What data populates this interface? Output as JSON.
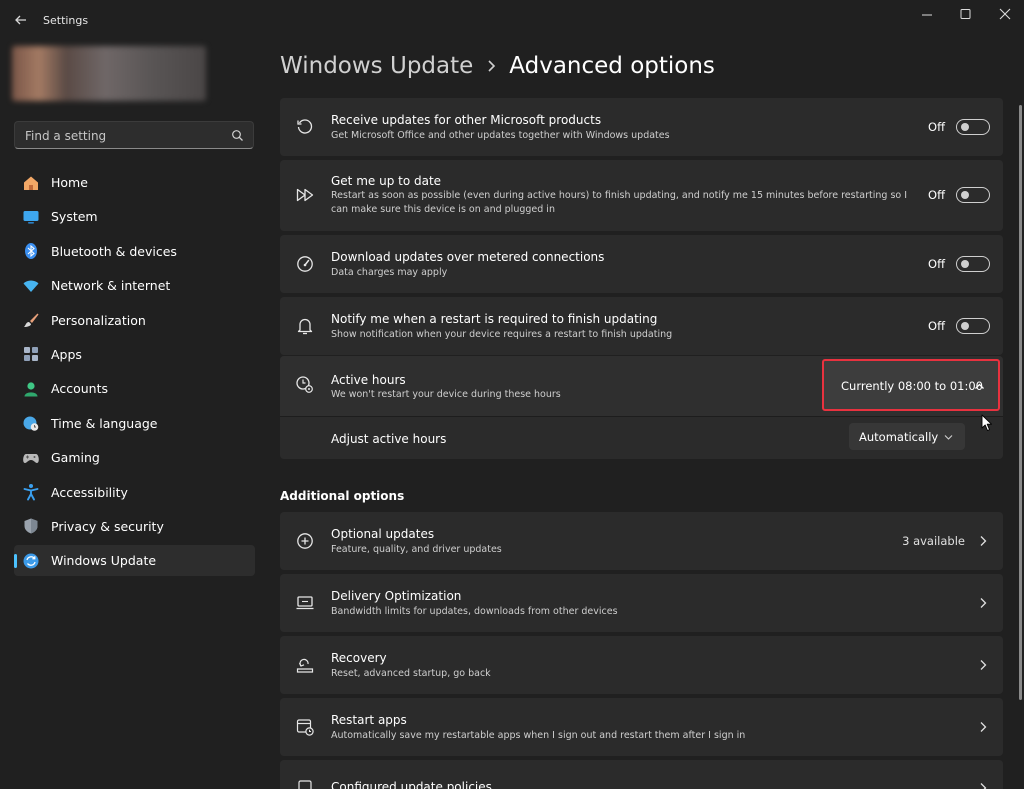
{
  "window": {
    "title": "Settings"
  },
  "search": {
    "placeholder": "Find a setting"
  },
  "sidebar": {
    "items": [
      {
        "label": "Home",
        "icon": "home-icon",
        "color": "#f2a766"
      },
      {
        "label": "System",
        "icon": "system-icon",
        "color": "#3ea7ef"
      },
      {
        "label": "Bluetooth & devices",
        "icon": "bluetooth-icon",
        "color": "#3b8ff0"
      },
      {
        "label": "Network & internet",
        "icon": "network-icon",
        "color": "#47b4f0"
      },
      {
        "label": "Personalization",
        "icon": "brush-icon",
        "color": "#e8a07a"
      },
      {
        "label": "Apps",
        "icon": "apps-icon",
        "color": "#a9b6c9"
      },
      {
        "label": "Accounts",
        "icon": "accounts-icon",
        "color": "#3fc785"
      },
      {
        "label": "Time & language",
        "icon": "globe-clock-icon",
        "color": "#4aa8e8"
      },
      {
        "label": "Gaming",
        "icon": "gamepad-icon",
        "color": "#b9b9b9"
      },
      {
        "label": "Accessibility",
        "icon": "accessibility-icon",
        "color": "#3aa0f0"
      },
      {
        "label": "Privacy & security",
        "icon": "shield-icon",
        "color": "#9aa3ad"
      },
      {
        "label": "Windows Update",
        "icon": "update-icon",
        "color": "#3b9ae8",
        "selected": true
      }
    ]
  },
  "header": {
    "parent": "Windows Update",
    "current": "Advanced options"
  },
  "settings": [
    {
      "title": "Receive updates for other Microsoft products",
      "desc": "Get Microsoft Office and other updates together with Windows updates",
      "state": "Off"
    },
    {
      "title": "Get me up to date",
      "desc": "Restart as soon as possible (even during active hours) to finish updating, and notify me 15 minutes before restarting so I can make sure this device is on and plugged in",
      "state": "Off"
    },
    {
      "title": "Download updates over metered connections",
      "desc": "Data charges may apply",
      "state": "Off"
    },
    {
      "title": "Notify me when a restart is required to finish updating",
      "desc": "Show notification when your device requires a restart to finish updating",
      "state": "Off"
    }
  ],
  "active_hours": {
    "title": "Active hours",
    "desc": "We won't restart your device during these hours",
    "current": "Currently 08:00 to 01:00",
    "adjust_label": "Adjust active hours",
    "adjust_value": "Automatically"
  },
  "additional": {
    "title": "Additional options",
    "items": [
      {
        "title": "Optional updates",
        "desc": "Feature, quality, and driver updates",
        "value": "3 available"
      },
      {
        "title": "Delivery Optimization",
        "desc": "Bandwidth limits for updates, downloads from other devices"
      },
      {
        "title": "Recovery",
        "desc": "Reset, advanced startup, go back"
      },
      {
        "title": "Restart apps",
        "desc": "Automatically save my restartable apps when I sign out and restart them after I sign in"
      },
      {
        "title": "Configured update policies",
        "desc": ""
      }
    ]
  },
  "colors": {
    "accent": "#4cc2ff",
    "highlight": "#e8323f",
    "card": "#2b2b2b",
    "background": "#202020"
  }
}
